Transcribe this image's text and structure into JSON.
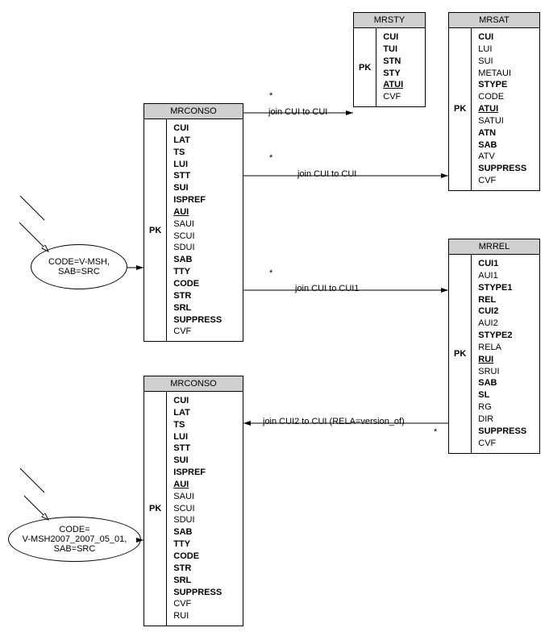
{
  "tables": {
    "mrconso1": {
      "title": "MRCONSO",
      "pk": "PK",
      "fields": [
        {
          "t": "CUI",
          "b": true
        },
        {
          "t": "LAT",
          "b": true
        },
        {
          "t": "TS",
          "b": true
        },
        {
          "t": "LUI",
          "b": true
        },
        {
          "t": "STT",
          "b": true
        },
        {
          "t": "SUI",
          "b": true
        },
        {
          "t": "ISPREF",
          "b": true
        },
        {
          "t": "AUI",
          "b": true,
          "u": true
        },
        {
          "t": "SAUI"
        },
        {
          "t": "SCUI"
        },
        {
          "t": "SDUI"
        },
        {
          "t": "SAB",
          "b": true
        },
        {
          "t": "TTY",
          "b": true
        },
        {
          "t": "CODE",
          "b": true
        },
        {
          "t": "STR",
          "b": true
        },
        {
          "t": "SRL",
          "b": true
        },
        {
          "t": "SUPPRESS",
          "b": true
        },
        {
          "t": "CVF"
        }
      ]
    },
    "mrconso2": {
      "title": "MRCONSO",
      "pk": "PK",
      "fields": [
        {
          "t": "CUI",
          "b": true
        },
        {
          "t": "LAT",
          "b": true
        },
        {
          "t": "TS",
          "b": true
        },
        {
          "t": "LUI",
          "b": true
        },
        {
          "t": "STT",
          "b": true
        },
        {
          "t": "SUI",
          "b": true
        },
        {
          "t": "ISPREF",
          "b": true
        },
        {
          "t": "AUI",
          "b": true,
          "u": true
        },
        {
          "t": "SAUI"
        },
        {
          "t": "SCUI"
        },
        {
          "t": "SDUI"
        },
        {
          "t": "SAB",
          "b": true
        },
        {
          "t": "TTY",
          "b": true
        },
        {
          "t": "CODE",
          "b": true
        },
        {
          "t": "STR",
          "b": true
        },
        {
          "t": "SRL",
          "b": true
        },
        {
          "t": "SUPPRESS",
          "b": true
        },
        {
          "t": "CVF"
        },
        {
          "t": "RUI"
        }
      ]
    },
    "mrsty": {
      "title": "MRSTY",
      "pk": "PK",
      "fields": [
        {
          "t": "CUI",
          "b": true
        },
        {
          "t": "TUI",
          "b": true
        },
        {
          "t": "STN",
          "b": true
        },
        {
          "t": "STY",
          "b": true
        },
        {
          "t": "ATUI",
          "b": true,
          "u": true
        },
        {
          "t": "CVF"
        }
      ]
    },
    "mrsat": {
      "title": "MRSAT",
      "pk": "PK",
      "fields": [
        {
          "t": "CUI",
          "b": true
        },
        {
          "t": "LUI"
        },
        {
          "t": "SUI"
        },
        {
          "t": "METAUI"
        },
        {
          "t": "STYPE",
          "b": true
        },
        {
          "t": "CODE"
        },
        {
          "t": "ATUI",
          "b": true,
          "u": true
        },
        {
          "t": "SATUI"
        },
        {
          "t": "ATN",
          "b": true
        },
        {
          "t": "SAB",
          "b": true
        },
        {
          "t": "ATV"
        },
        {
          "t": "SUPPRESS",
          "b": true
        },
        {
          "t": "CVF"
        }
      ]
    },
    "mrrel": {
      "title": "MRREL",
      "pk": "PK",
      "fields": [
        {
          "t": "CUI1",
          "b": true
        },
        {
          "t": "AUI1"
        },
        {
          "t": "STYPE1",
          "b": true
        },
        {
          "t": "REL",
          "b": true
        },
        {
          "t": "CUI2",
          "b": true
        },
        {
          "t": "AUI2"
        },
        {
          "t": "STYPE2",
          "b": true
        },
        {
          "t": "RELA"
        },
        {
          "t": "RUI",
          "b": true,
          "u": true
        },
        {
          "t": "SRUI"
        },
        {
          "t": "SAB",
          "b": true
        },
        {
          "t": "SL",
          "b": true
        },
        {
          "t": "RG"
        },
        {
          "t": "DIR"
        },
        {
          "t": "SUPPRESS",
          "b": true
        },
        {
          "t": "CVF"
        }
      ]
    }
  },
  "ellipses": {
    "e1": "CODE=V-MSH,\nSAB=SRC",
    "e2": "CODE=\nV-MSH2007_2007_05_01,\nSAB=SRC"
  },
  "labels": {
    "j1": "join CUI to CUI",
    "j2": "join CUI to CUI",
    "j3": "join CUI to CUI1",
    "j4": "join CUI2 to CUI (RELA=version_of)",
    "star": "*"
  }
}
